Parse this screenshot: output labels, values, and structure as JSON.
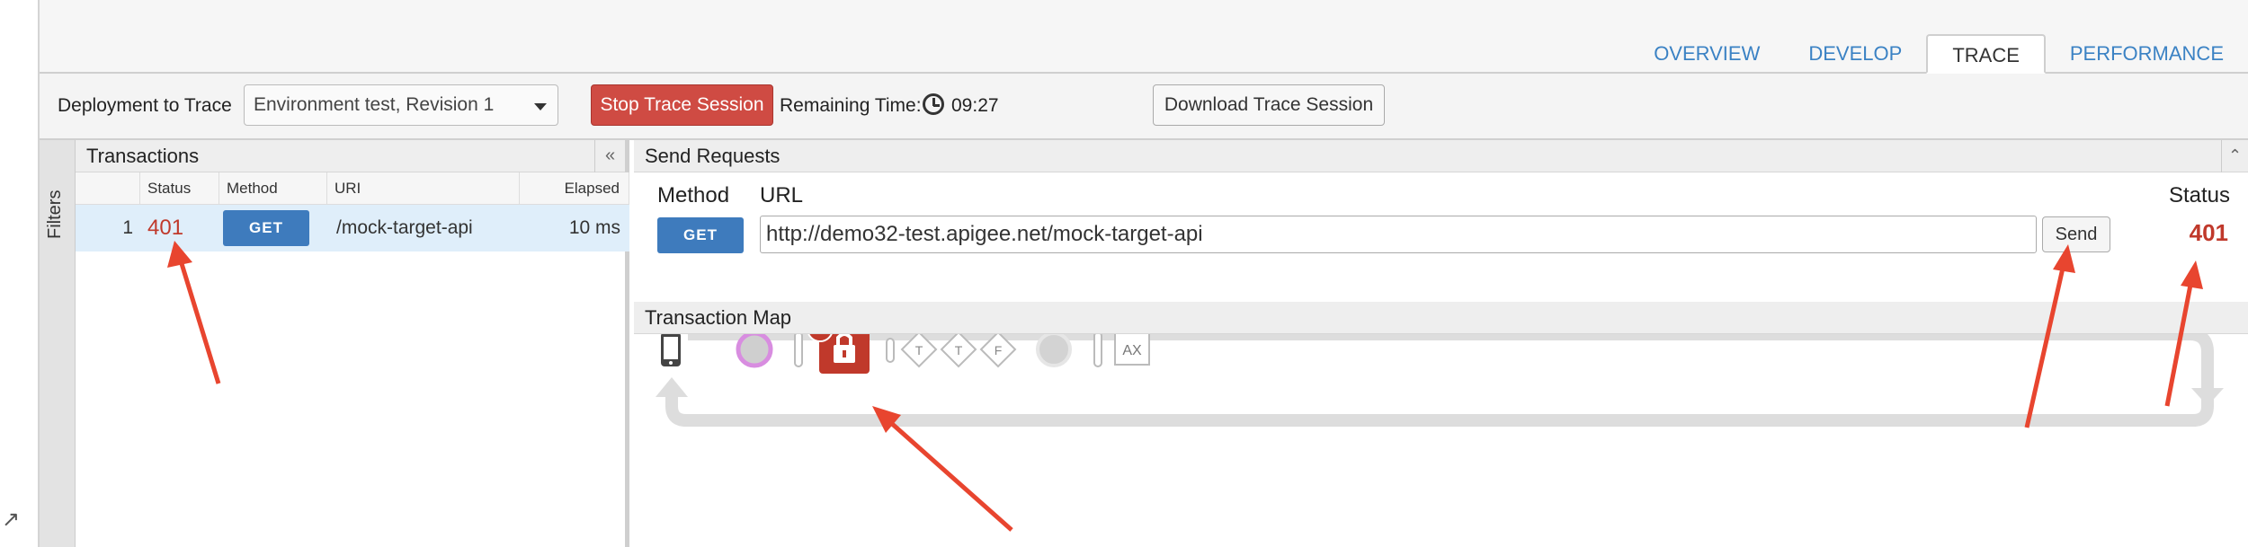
{
  "tabs": [
    {
      "label": "OVERVIEW"
    },
    {
      "label": "DEVELOP"
    },
    {
      "label": "TRACE"
    },
    {
      "label": "PERFORMANCE"
    }
  ],
  "toolbar": {
    "deployment_label": "Deployment to Trace",
    "environment_value": "Environment test, Revision 1",
    "stop_label": "Stop Trace Session",
    "remaining_label": "Remaining Time:",
    "remaining_time": "09:27",
    "download_label": "Download Trace Session"
  },
  "filters": {
    "label": "Filters"
  },
  "transactions": {
    "title": "Transactions",
    "collapse_icon": "«",
    "columns": [
      "Status",
      "Method",
      "URI",
      "Elapsed"
    ],
    "rows": [
      {
        "num": "1",
        "status": "401",
        "method": "GET",
        "uri": "/mock-target-api",
        "elapsed": "10 ms"
      }
    ]
  },
  "send_requests": {
    "title": "Send Requests",
    "method_label": "Method",
    "url_label": "URL",
    "status_label": "Status",
    "method": "GET",
    "url": "http://demo32-test.apigee.net/mock-target-api",
    "send_label": "Send",
    "status": "401"
  },
  "transaction_map": {
    "title": "Transaction Map",
    "nodes": [
      "T",
      "T",
      "F"
    ],
    "ax_label": "AX"
  },
  "colors": {
    "accent": "#3e7bbd",
    "error": "#c0392b",
    "lock": "#c0392b",
    "arrow": "#e8452f"
  },
  "icons": {
    "expand": "↗",
    "collapse": "«",
    "clock": "clock-icon",
    "lock": "lock-icon",
    "phone": "phone-icon"
  }
}
